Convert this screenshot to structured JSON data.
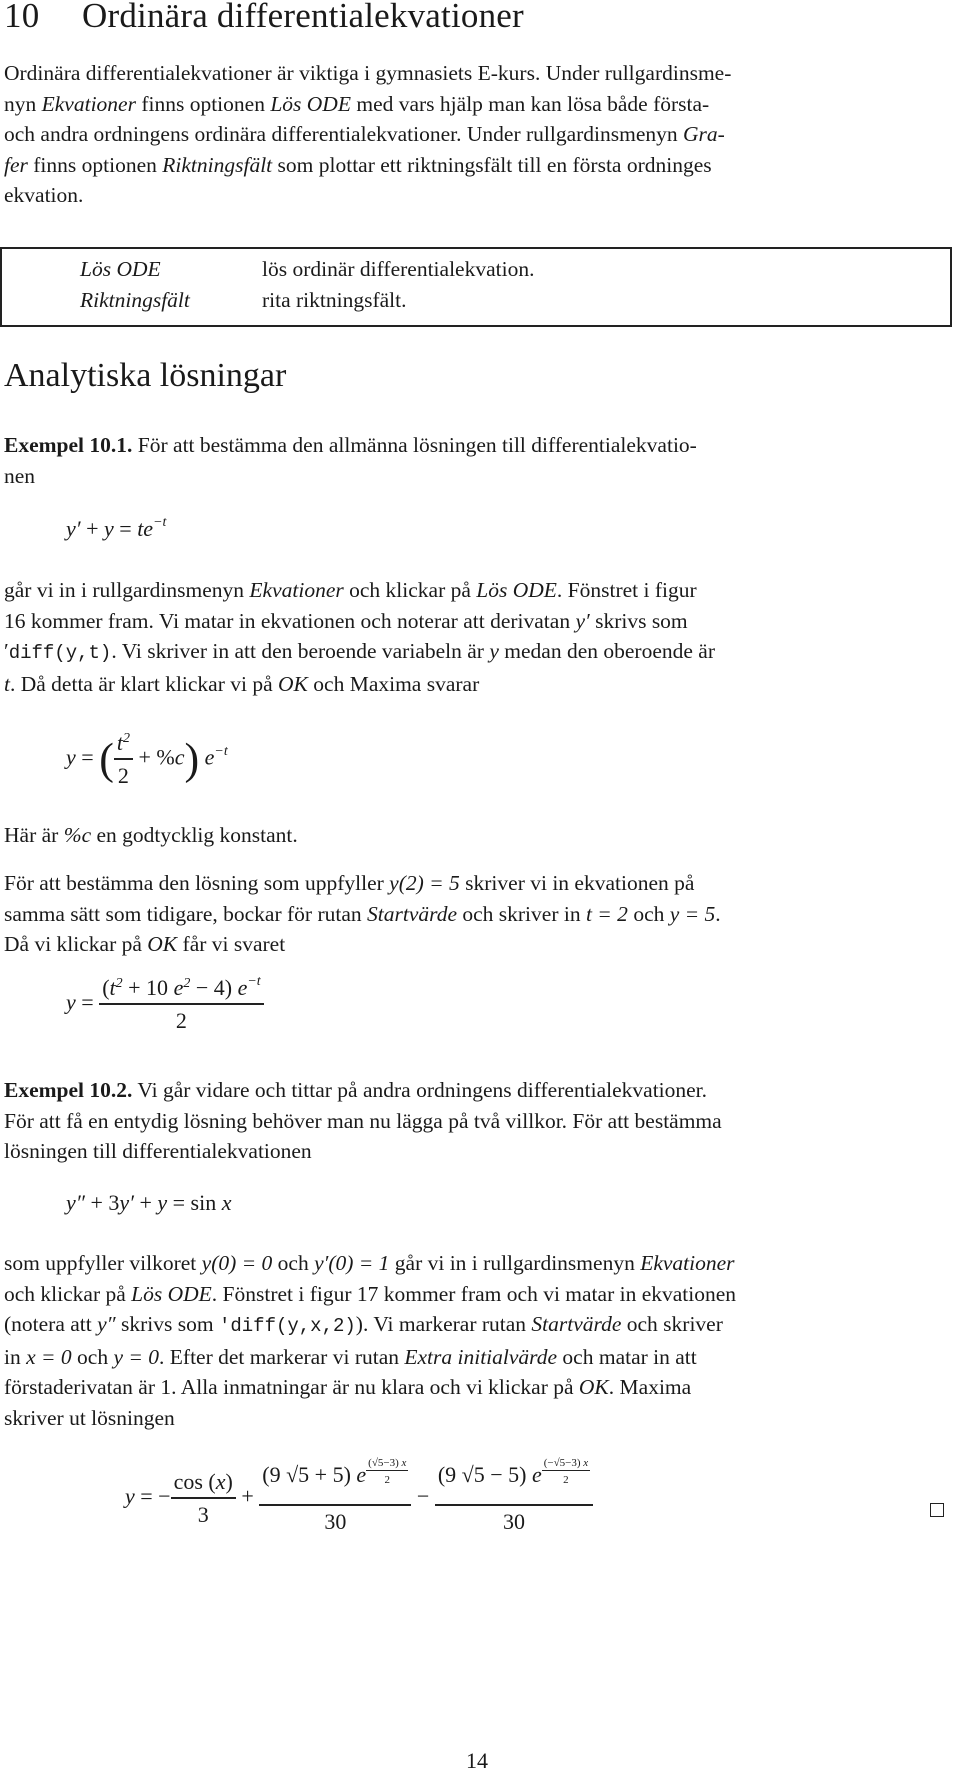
{
  "chapter": {
    "number": "10",
    "title": "Ordinära differentialekvationer"
  },
  "intro": {
    "t1": "Ordinära differentialekvationer är viktiga i gymnasiets E-kurs. Under rullgardinsme-",
    "t2a": "nyn ",
    "t2b": "Ekvationer",
    "t2c": " finns optionen ",
    "t2d": "Lös ODE",
    "t2e": " med vars hjälp man kan lösa både första-",
    "t3a": "och andra ordningens ordinära differentialekvationer. Under rullgardinsmenyn ",
    "t3b": "Gra-",
    "t4a": "fer",
    "t4b": " finns optionen ",
    "t4c": "Riktningsfält",
    "t4d": " som plottar ett riktningsfält till en första ordninges",
    "t5": "ekvation."
  },
  "menu_box": {
    "rows": [
      {
        "term": "Lös ODE",
        "description": "lös ordinär differentialekvation."
      },
      {
        "term": "Riktningsfält",
        "description": "rita riktningsfält."
      }
    ]
  },
  "section": {
    "title": "Analytiska lösningar"
  },
  "example1": {
    "label": "Exempel 10.1.",
    "intro_a": " För att bestämma den allmänna lösningen till differentialekvatio-",
    "intro_b": "nen",
    "equation": "y′ + y = te^(−t)",
    "p1a": "går vi in i rullgardinsmenyn ",
    "p1b": "Ekvationer",
    "p1c": " och klickar på ",
    "p1d": "Lös ODE",
    "p1e": ". Fönstret i figur",
    "p2a": "16 kommer fram. Vi matar in ekvationen och noterar att derivatan ",
    "p2b": "y′",
    "p2c": " skrivs som",
    "p3a": "′",
    "p3b": "diff(y,t)",
    "p3c": ". Vi skriver in att den beroende variabeln är ",
    "p3d": "y",
    "p3e": " medan den oberoende är",
    "p4a": "t",
    "p4b": ". Då detta är klart klickar vi på ",
    "p4c": "OK",
    "p4d": " och Maxima svarar",
    "solution": "y = (t²/2 + %c) e^(−t)",
    "note_a": "Här är ",
    "note_b": "%c",
    "note_c": " en godtycklig konstant.",
    "q1a": "För att bestämma den lösning som uppfyller ",
    "q1b": "y(2) = 5",
    "q1c": " skriver vi in ekvationen på",
    "q2a": "samma sätt som tidigare, bockar för rutan ",
    "q2b": "Startvärde",
    "q2c": " och skriver in ",
    "q2d": "t = 2",
    "q2e": " och ",
    "q2f": "y = 5",
    "q2g": ".",
    "q3a": "Då vi klickar på ",
    "q3b": "OK",
    "q3c": " får vi svaret",
    "particular_solution": "y = ((t² + 10e² − 4) e^(−t)) / 2"
  },
  "example2": {
    "label": "Exempel 10.2.",
    "l1": " Vi går vidare och tittar på andra ordningens differentialekvationer.",
    "l2": "För att få en entydig lösning behöver man nu lägga på två villkor. För att bestämma",
    "l3": "lösningen till differentialekvationen",
    "equation": "y″ + 3y′ + y = sin x",
    "m1a": "som uppfyller vilkoret ",
    "m1b": "y(0) = 0",
    "m1c": " och ",
    "m1d": "y′(0) = 1",
    "m1e": " går vi in i rullgardinsmenyn ",
    "m1f": "Ekvationer",
    "m2a": "och klickar på ",
    "m2b": "Lös ODE",
    "m2c": ". Fönstret i figur 17 kommer fram och vi matar in ekvationen",
    "m3a": "(notera att ",
    "m3b": "y″",
    "m3c": " skrivs som ",
    "m3d": "′diff(y,x,2)",
    "m3e": "). Vi markerar rutan ",
    "m3f": "Startvärde",
    "m3g": " och skriver",
    "m4a": "in ",
    "m4b": "x = 0",
    "m4c": " och ",
    "m4d": "y = 0",
    "m4e": ". Efter det markerar vi rutan ",
    "m4f": "Extra initialvärde",
    "m4g": " och matar in att",
    "m5a": "förstaderivatan är 1. Alla inmatningar är nu klara och vi klickar på ",
    "m5b": "OK",
    "m5c": ". Maxima",
    "m6": "skriver ut lösningen",
    "solution": "y = −cos(x)/3 + ((9√5 + 5) e^(((√5 − 3) x)/2))/30 − ((9√5 − 5) e^(((−√5 − 3) x)/2))/30"
  },
  "page_number": "14"
}
